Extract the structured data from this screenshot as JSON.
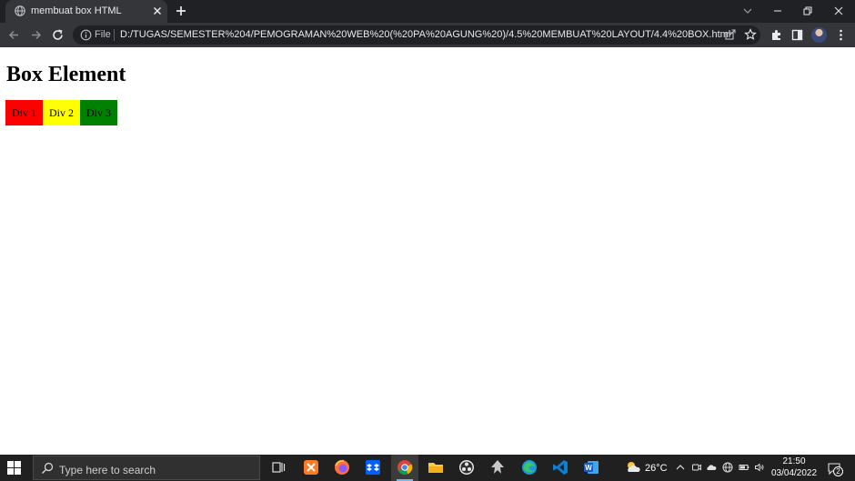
{
  "browser": {
    "tab": {
      "title": "membuat box HTML"
    },
    "omnibox": {
      "scheme_label": "File",
      "url": "D:/TUGAS/SEMESTER%204/PEMOGRAMAN%20WEB%20(%20PA%20AGUNG%20)/4.5%20MEMBUAT%20LAYOUT/4.4%20BOX.html"
    }
  },
  "page": {
    "heading": "Box Element",
    "boxes": [
      {
        "label": "Div 1",
        "color": "#ff0000"
      },
      {
        "label": "Div 2",
        "color": "#ffff00"
      },
      {
        "label": "Div 3",
        "color": "#008000"
      }
    ]
  },
  "taskbar": {
    "search_placeholder": "Type here to search",
    "weather": {
      "temperature": "26°C",
      "icon": "partly-cloudy-icon"
    },
    "clock": {
      "time": "21:50",
      "date": "03/04/2022"
    },
    "notification_count": "2"
  }
}
